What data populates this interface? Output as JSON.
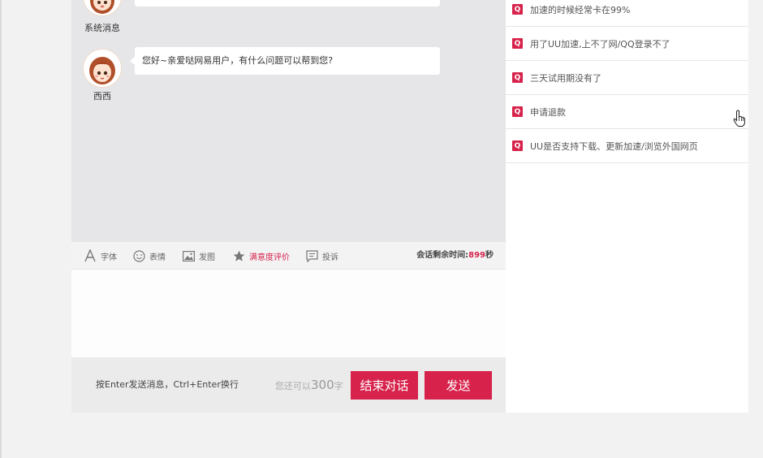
{
  "messages": [
    {
      "sender": "系统消息",
      "text": "",
      "avatar": "girl-avatar"
    },
    {
      "sender": "西西",
      "text": "您好~亲爱哒网易用户，有什么问题可以帮到您?",
      "avatar": "girl-avatar"
    }
  ],
  "toolbar": {
    "font_label": "字体",
    "emoji_label": "表情",
    "image_label": "发图",
    "rating_label": "满意度评价",
    "complaint_label": "投诉",
    "timer_label": "会话剩余时间:",
    "timer_value": "899",
    "timer_unit": "秒"
  },
  "input": {
    "value": ""
  },
  "footer": {
    "hint": "按Enter发送消息，Ctrl+Enter换行",
    "remain_prefix": "您还可以",
    "remain_count": "300",
    "remain_suffix": "字",
    "end_button": "结束对话",
    "send_button": "发送"
  },
  "faq": {
    "badge": "Q",
    "items": [
      "加速的时候经常卡在99%",
      "用了UU加速,上不了网/QQ登录不了",
      "三天试用期没有了",
      "申请退款",
      "UU是否支持下载、更新加速/浏览外国网页"
    ]
  },
  "colors": {
    "accent": "#d7224b",
    "chat_bg": "#e6e6e8",
    "page_bg": "#f2f2f2"
  }
}
